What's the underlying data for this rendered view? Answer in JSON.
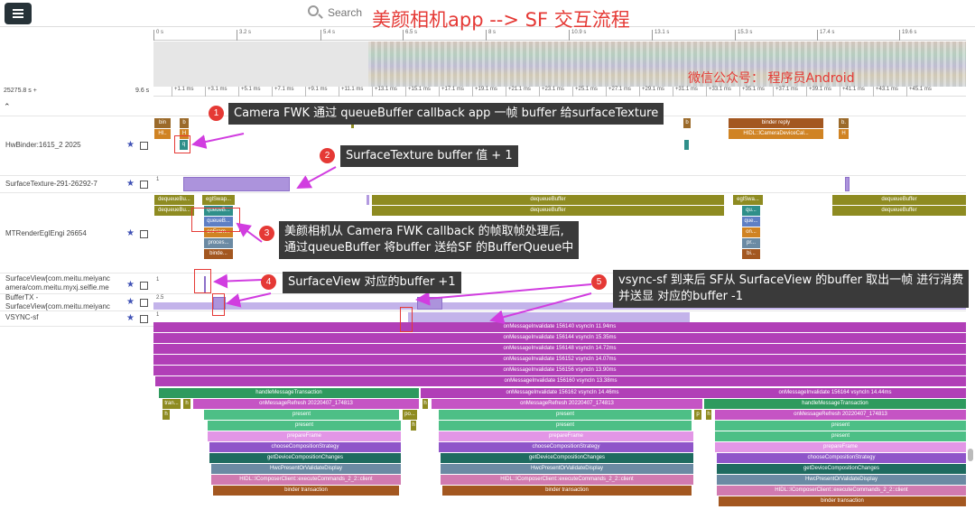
{
  "header": {
    "title": "美颜相机app --> SF 交互流程",
    "search_placeholder": "Search"
  },
  "overview": {
    "ruler_ticks": [
      "0 s",
      "3.2 s",
      "5.4 s",
      "6.5 s",
      "8 s",
      "10.9 s",
      "13.1 s",
      "15.3 s",
      "17.4 s",
      "19.6 s"
    ],
    "wechat": "微信公众号：  程序员Android"
  },
  "timeline": {
    "start_label": "25275.8 s +",
    "span_label": "9.6 s",
    "ticks": [
      "+1.1 ms",
      "+3.1 ms",
      "+5.1 ms",
      "+7.1 ms",
      "+9.1 ms",
      "+11.1 ms",
      "+13.1 ms",
      "+15.1 ms",
      "+17.1 ms",
      "+19.1 ms",
      "+21.1 ms",
      "+23.1 ms",
      "+25.1 ms",
      "+27.1 ms",
      "+29.1 ms",
      "+31.1 ms",
      "+33.1 ms",
      "+35.1 ms",
      "+37.1 ms",
      "+39.1 ms",
      "+41.1 ms",
      "+43.1 ms",
      "+45.1 ms"
    ]
  },
  "tracks": {
    "hwbinder": {
      "label": "HwBinder:1615_2 2025",
      "slices": [
        "bin",
        "b",
        "HI..",
        "H",
        "q",
        "b",
        "binder reply",
        "HIDL::ICameraDeviceCal...",
        "b.",
        "H"
      ]
    },
    "surfacetexture": {
      "label": "SurfaceTexture-291-26292-7",
      "value": "1"
    },
    "mtrender": {
      "label": "MTRenderEglEngi 26654",
      "slices": [
        "dequeueBu...",
        "eglSwap...",
        "dequeueBu...",
        "queueB...",
        "queueB...",
        "onFram...",
        "proces...",
        "binde...",
        "dequeueBuffer",
        "dequeueBuffer",
        "eglSwa...",
        "qu...",
        "que...",
        "on...",
        "pr...",
        "bi...",
        "dequeueBuffer",
        "dequeueBuffer"
      ]
    },
    "surfaceview": {
      "label1": "SurfaceView[com.meitu.meiyanc",
      "label2": "amera/com.meitu.myxj.selfie.me",
      "value": "1"
    },
    "buffertx": {
      "label1": "BufferTX -",
      "label2": "SurfaceView[com.meitu.meiyanc",
      "value": "2.5"
    },
    "vsync": {
      "label": "VSYNC-sf",
      "value": "1"
    }
  },
  "sf_slices": {
    "invalidate_rows": [
      "onMessageInvalidate 156140 vsyncIn 11.94ms",
      "onMessageInvalidate 156144 vsyncIn 15.35ms",
      "onMessageInvalidate 156148 vsyncIn 14.72ms",
      "onMessageInvalidate 156152 vsyncIn 14.07ms",
      "onMessageInvalidate 156156 vsyncIn 13.90ms",
      "onMessageInvalidate 156160 vsyncIn 13.38ms"
    ],
    "block1": {
      "head": "handleMessageTransaction",
      "small": [
        "tran...",
        "h",
        "h",
        "po...",
        "h"
      ],
      "refresh": "onMessageRefresh 20220407_174813",
      "rows": [
        "present",
        "present",
        "prepareFrame",
        "chooseCompositionStrategy",
        "getDeviceCompositionChanges",
        "HwcPresentOrValidateDisplay",
        "HIDL::IComposerClient::executeCommands_2_2::client",
        "binder transaction"
      ]
    },
    "block2": {
      "head": "onMessageInvalidate 156162 vsyncIn 14.46ms",
      "small": [
        "h",
        "p"
      ],
      "refresh": "onMessageRefresh 20220407_174813",
      "rows": [
        "present",
        "present",
        "prepareFrame",
        "chooseCompositionStrategy",
        "getDeviceCompositionChanges",
        "HwcPresentOrValidateDisplay",
        "HIDL::IComposerClient::executeCommands_2_2::client",
        "binder transaction"
      ]
    },
    "block3": {
      "head": "onMessageInvalidate 156164 vsyncIn 14.44ms",
      "head2": "handleMessageTransaction",
      "small": [
        "h"
      ],
      "refresh": "onMessageRefresh 20220407_174813",
      "rows": [
        "present",
        "present",
        "prepareFrame",
        "chooseCompositionStrategy",
        "getDeviceCompositionChanges",
        "HwcPresentOrValidateDisplay",
        "HIDL::IComposerClient::executeCommands_2_2::client",
        "binder transaction"
      ]
    }
  },
  "annotations": [
    {
      "num": "1",
      "lines": [
        "Camera FWK 通过 queueBuffer callback app 一帧 buffer 给surfaceTexture"
      ]
    },
    {
      "num": "2",
      "lines": [
        "SurfaceTexture buffer 值 + 1"
      ]
    },
    {
      "num": "3",
      "lines": [
        "美颜相机从 Camera FWK callback 的帧取帧处理后,",
        "通过queueBuffer 将buffer 送给SF 的BufferQueue中"
      ]
    },
    {
      "num": "4",
      "lines": [
        "SurfaceView 对应的buffer +1"
      ]
    },
    {
      "num": "5",
      "lines": [
        "vsync-sf 到来后 SF从 SurfaceView 的buffer 取出一帧 进行消费",
        "并送显 对应的buffer -1"
      ]
    }
  ],
  "colors": {
    "title_red": "#e53935",
    "callout_bg": "#3a3a3a",
    "accent_magenta": "#b13fb7",
    "arrow": "#d13de0"
  },
  "icons": {
    "menu": "menu-icon",
    "search": "search-icon",
    "pin": "pin-icon",
    "collapse": "chevron-double-up-icon",
    "checkbox": "checkbox-icon"
  }
}
